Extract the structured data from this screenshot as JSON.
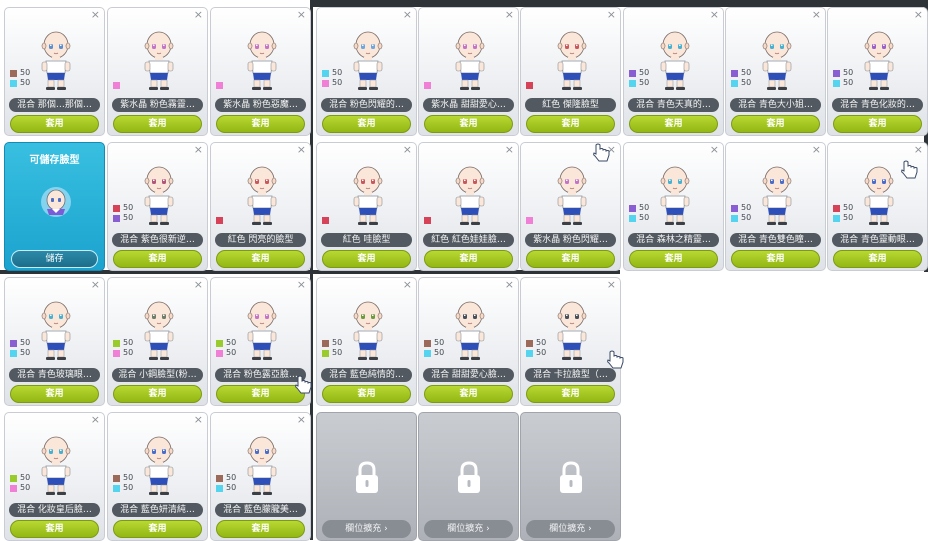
{
  "colors": {
    "brown": "#9b6a5a",
    "cyan": "#55d4f0",
    "pink": "#f07fd6",
    "purple": "#8a5ed3",
    "red": "#d64257",
    "lime": "#9acb2d",
    "apply_button": "#a2c71b",
    "save_card": "#2bb3da",
    "locked_card": "#b8bbc1"
  },
  "labels": {
    "apply": "套用",
    "save_title": "可儲存臉型",
    "save_button": "儲存",
    "expand": "欄位擴充"
  },
  "close_glyph": "×",
  "rows": [
    [
      {
        "name": "混合  那個…那個…",
        "swatches": [
          {
            "color": "brown",
            "value": "50"
          },
          {
            "color": "cyan",
            "value": "50"
          }
        ],
        "eye": "#5a8fd0"
      },
      {
        "name": "紫水晶  粉色霧靈…",
        "swatches": [
          {
            "color": "pink",
            "value": ""
          }
        ],
        "eye": "#c374c7"
      },
      {
        "name": "紫水晶  粉色惡魔…",
        "swatches": [
          {
            "color": "pink",
            "value": ""
          }
        ],
        "eye": "#c374c7"
      },
      {
        "name": "混合  粉色閃耀的…",
        "swatches": [
          {
            "color": "cyan",
            "value": "50"
          },
          {
            "color": "pink",
            "value": "50"
          }
        ],
        "eye": "#6fa6dd"
      },
      {
        "name": "紫水晶  甜甜愛心…",
        "swatches": [
          {
            "color": "pink",
            "value": ""
          }
        ],
        "eye": "#c374c7"
      },
      {
        "name": "紅色  傑隆臉型",
        "swatches": [
          {
            "color": "red",
            "value": ""
          }
        ],
        "eye": "#c9585e"
      },
      {
        "name": "混合  青色天真的…",
        "swatches": [
          {
            "color": "purple",
            "value": "50"
          },
          {
            "color": "cyan",
            "value": "50"
          }
        ],
        "eye": "#4ab0cf"
      },
      {
        "name": "混合  青色大小姐…",
        "swatches": [
          {
            "color": "purple",
            "value": "50"
          },
          {
            "color": "cyan",
            "value": "50"
          }
        ],
        "eye": "#4ab0cf"
      },
      {
        "name": "混合  青色化妝的…",
        "swatches": [
          {
            "color": "purple",
            "value": "50"
          },
          {
            "color": "cyan",
            "value": "50"
          }
        ],
        "eye": "#9c5fc9"
      }
    ],
    [
      {
        "type": "save"
      },
      {
        "name": "混合  紫色很新逆…",
        "swatches": [
          {
            "color": "red",
            "value": "50"
          },
          {
            "color": "purple",
            "value": "50"
          }
        ],
        "eye": "#b0567a"
      },
      {
        "name": "紅色  閃亮的臉型",
        "swatches": [
          {
            "color": "red",
            "value": ""
          }
        ],
        "eye": "#c9585e"
      },
      {
        "name": "紅色  哇臉型",
        "swatches": [
          {
            "color": "red",
            "value": ""
          }
        ],
        "eye": "#c9585e"
      },
      {
        "name": "紅色  紅色娃娃臉…",
        "swatches": [
          {
            "color": "red",
            "value": ""
          }
        ],
        "eye": "#c9585e"
      },
      {
        "name": "紫水晶  粉色閃耀…",
        "swatches": [
          {
            "color": "pink",
            "value": ""
          }
        ],
        "eye": "#c374c7"
      },
      {
        "name": "混合  森林之精靈…",
        "swatches": [
          {
            "color": "purple",
            "value": "50"
          },
          {
            "color": "cyan",
            "value": "50"
          }
        ],
        "eye": "#4ab0cf"
      },
      {
        "name": "混合  青色雙色瞳…",
        "swatches": [
          {
            "color": "purple",
            "value": "50"
          },
          {
            "color": "cyan",
            "value": "50"
          }
        ],
        "eye": "#4b6dc8"
      },
      {
        "name": "混合  青色靈動眼…",
        "swatches": [
          {
            "color": "red",
            "value": "50"
          },
          {
            "color": "cyan",
            "value": "50"
          }
        ],
        "eye": "#4b6dc8"
      }
    ],
    [
      {
        "name": "混合  青色玻璃眼…",
        "swatches": [
          {
            "color": "purple",
            "value": "50"
          },
          {
            "color": "cyan",
            "value": "50"
          }
        ],
        "eye": "#4ab0cf"
      },
      {
        "name": "混合  小鋼臉型(粉…",
        "swatches": [
          {
            "color": "lime",
            "value": "50"
          },
          {
            "color": "pink",
            "value": "50"
          }
        ],
        "eye": "#6e7c6a"
      },
      {
        "name": "混合  粉色露亞臉…",
        "swatches": [
          {
            "color": "lime",
            "value": "50"
          },
          {
            "color": "pink",
            "value": "50"
          }
        ],
        "eye": "#c374c7"
      },
      {
        "name": "混合  藍色純情的…",
        "swatches": [
          {
            "color": "brown",
            "value": "50"
          },
          {
            "color": "lime",
            "value": "50"
          }
        ],
        "eye": "#6a9b3c"
      },
      {
        "name": "混合  甜甜愛心臉…",
        "swatches": [
          {
            "color": "brown",
            "value": "50"
          },
          {
            "color": "cyan",
            "value": "50"
          }
        ],
        "eye": "#46505a"
      },
      {
        "name": "混合  卡拉臉型（…",
        "swatches": [
          {
            "color": "brown",
            "value": "50"
          },
          {
            "color": "cyan",
            "value": "50"
          }
        ],
        "eye": "#46505a"
      }
    ],
    [
      {
        "name": "混合  化妝皇后臉…",
        "swatches": [
          {
            "color": "lime",
            "value": "50"
          },
          {
            "color": "pink",
            "value": "50"
          }
        ],
        "eye": "#4ab0cf"
      },
      {
        "name": "混合  藍色妍清純…",
        "swatches": [
          {
            "color": "brown",
            "value": "50"
          },
          {
            "color": "cyan",
            "value": "50"
          }
        ],
        "eye": "#4b6dc8"
      },
      {
        "name": "混合  藍色朦朧美…",
        "swatches": [
          {
            "color": "brown",
            "value": "50"
          },
          {
            "color": "cyan",
            "value": "50"
          }
        ],
        "eye": "#4b6dc8"
      },
      {
        "type": "locked"
      },
      {
        "type": "locked"
      },
      {
        "type": "locked"
      }
    ]
  ]
}
